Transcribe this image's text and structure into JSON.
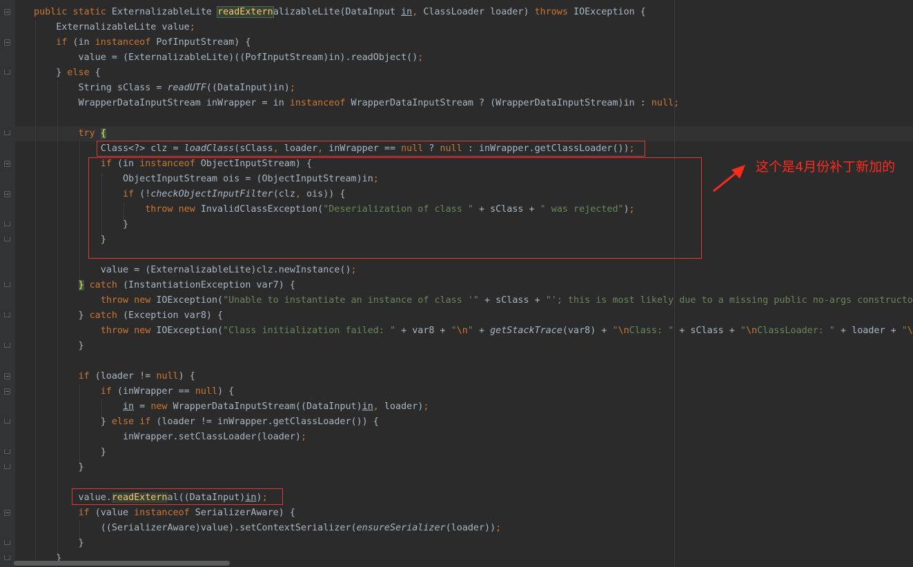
{
  "code_lines": [
    "public static ExternalizableLite readExternalizableLite(DataInput in, ClassLoader loader) throws IOException {",
    "    ExternalizableLite value;",
    "    if (in instanceof PofInputStream) {",
    "        value = (ExternalizableLite)((PofInputStream)in).readObject();",
    "    } else {",
    "        String sClass = readUTF((DataInput)in);",
    "        WrapperDataInputStream inWrapper = in instanceof WrapperDataInputStream ? (WrapperDataInputStream)in : null;",
    "",
    "        try {",
    "            Class<?> clz = loadClass(sClass, loader, inWrapper == null ? null : inWrapper.getClassLoader());",
    "            if (in instanceof ObjectInputStream) {",
    "                ObjectInputStream ois = (ObjectInputStream)in;",
    "                if (!checkObjectInputFilter(clz, ois)) {",
    "                    throw new InvalidClassException(\"Deserialization of class \" + sClass + \" was rejected\");",
    "                }",
    "            }",
    "",
    "            value = (ExternalizableLite)clz.newInstance();",
    "        } catch (InstantiationException var7) {",
    "            throw new IOException(\"Unable to instantiate an instance of class '\" + sClass + \"'; this is most likely due to a missing public no-args constructor",
    "        } catch (Exception var8) {",
    "            throw new IOException(\"Class initialization failed: \" + var8 + \"\\n\" + getStackTrace(var8) + \"\\nClass: \" + sClass + \"\\nClassLoader: \" + loader + \"\\n",
    "        }",
    "",
    "        if (loader != null) {",
    "            if (inWrapper == null) {",
    "                in = new WrapperDataInputStream((DataInput)in, loader);",
    "            } else if (loader != inWrapper.getClassLoader()) {",
    "                inWrapper.setClassLoader(loader);",
    "            }",
    "        }",
    "",
    "        value.readExternal((DataInput)in);",
    "        if (value instanceof SerializerAware) {",
    "            ((SerializerAware)value).setContextSerializer(ensureSerializer(loader));",
    "        }",
    "    }"
  ],
  "annotation": {
    "text": "这个是4月份补丁新加的"
  },
  "colors": {
    "background": "#2b2b2b",
    "keyword": "#cc7832",
    "string": "#6a8759",
    "default_text": "#a9b7c6",
    "highlight": "#344134",
    "annotation": "#ff2b1f"
  },
  "icons": {
    "fold_markers": "fold-icon",
    "annotation_arrow": "arrow-icon"
  }
}
